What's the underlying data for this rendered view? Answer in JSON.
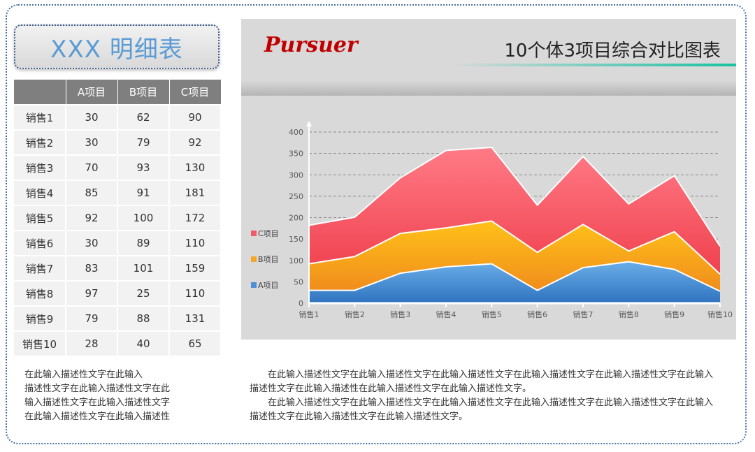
{
  "title": "XXX 明细表",
  "table": {
    "headers": [
      "",
      "A项目",
      "B项目",
      "C项目"
    ],
    "rows": [
      [
        "销售1",
        "30",
        "62",
        "90"
      ],
      [
        "销售2",
        "30",
        "79",
        "92"
      ],
      [
        "销售3",
        "70",
        "93",
        "130"
      ],
      [
        "销售4",
        "85",
        "91",
        "181"
      ],
      [
        "销售5",
        "92",
        "100",
        "172"
      ],
      [
        "销售6",
        "30",
        "89",
        "110"
      ],
      [
        "销售7",
        "83",
        "101",
        "159"
      ],
      [
        "销售8",
        "97",
        "25",
        "110"
      ],
      [
        "销售9",
        "79",
        "88",
        "131"
      ],
      [
        "销售10",
        "28",
        "40",
        "65"
      ]
    ]
  },
  "logo": "Pursuer",
  "chart_title": "10个体3项目综合对比图表",
  "chart_data": {
    "type": "area",
    "stacked": true,
    "title": "10个体3项目综合对比图表",
    "categories": [
      "销售1",
      "销售2",
      "销售3",
      "销售4",
      "销售5",
      "销售6",
      "销售7",
      "销售8",
      "销售9",
      "销售10"
    ],
    "series": [
      {
        "name": "A项目",
        "values": [
          30,
          30,
          70,
          85,
          92,
          30,
          83,
          97,
          79,
          28
        ],
        "color": "#4f8fd6"
      },
      {
        "name": "B项目",
        "values": [
          62,
          79,
          93,
          91,
          100,
          89,
          101,
          25,
          88,
          40
        ],
        "color": "#f5a623"
      },
      {
        "name": "C项目",
        "values": [
          90,
          92,
          130,
          181,
          172,
          110,
          159,
          110,
          131,
          65
        ],
        "color": "#f25a6a"
      }
    ],
    "yticks": [
      "0",
      "50",
      "100",
      "150",
      "200",
      "250",
      "300",
      "350",
      "400"
    ],
    "ylim": [
      0,
      400
    ],
    "grid": true,
    "legend": "left"
  },
  "desc_left": [
    "在此输入描述性文字在此输入",
    "描述性文字在此输入描述性文字在此",
    "输入描述性文字在此输入描述性文字",
    "在此输入描述性文字在此输入描述性"
  ],
  "desc_right": [
    "在此输入描述性文字在此输入描述性文字在此输入描述性文字在此输入描述性文字在此输入描述性文字在此输入描述性文字在此输入描述性在此输入描述性文字在此输入描述性文字。",
    "在此输入描述性文字在此输入描述性文字在此输入描述性文字在此输入描述性文字在此输入描述性文字在此输入描述性文字在此输入描述性文字在此输入描述性文字。"
  ]
}
